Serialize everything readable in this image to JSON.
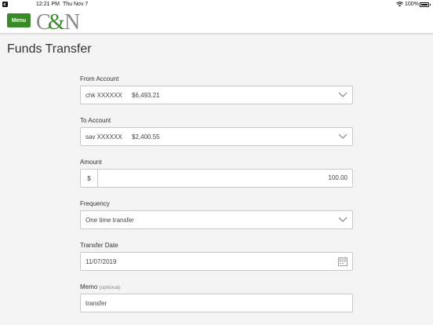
{
  "status_bar": {
    "time": "12:21 PM",
    "date": "Thu Nov 7",
    "battery": "100%"
  },
  "header": {
    "menu_label": "Menu",
    "logo_text": "C&N",
    "brand_colors": {
      "accent": "#3a8a2a",
      "logo_gray": "#888888"
    }
  },
  "page": {
    "title": "Funds Transfer"
  },
  "form": {
    "from_account": {
      "label": "From Account",
      "account": "chk XXXXXX",
      "balance": "$6,493.21"
    },
    "to_account": {
      "label": "To Account",
      "account": "sav XXXXXX",
      "balance": "$2,400.55"
    },
    "amount": {
      "label": "Amount",
      "currency": "$",
      "value": "100.00"
    },
    "frequency": {
      "label": "Frequency",
      "value": "One time transfer"
    },
    "transfer_date": {
      "label": "Transfer Date",
      "value": "11/07/2019"
    },
    "memo": {
      "label": "Memo",
      "optional": "(optional)",
      "value": "transfer"
    }
  },
  "icons": {
    "dropdown": "chevron-down-icon",
    "calendar": "calendar-icon",
    "wifi": "wifi-icon",
    "battery": "battery-icon",
    "back": "back-icon"
  }
}
